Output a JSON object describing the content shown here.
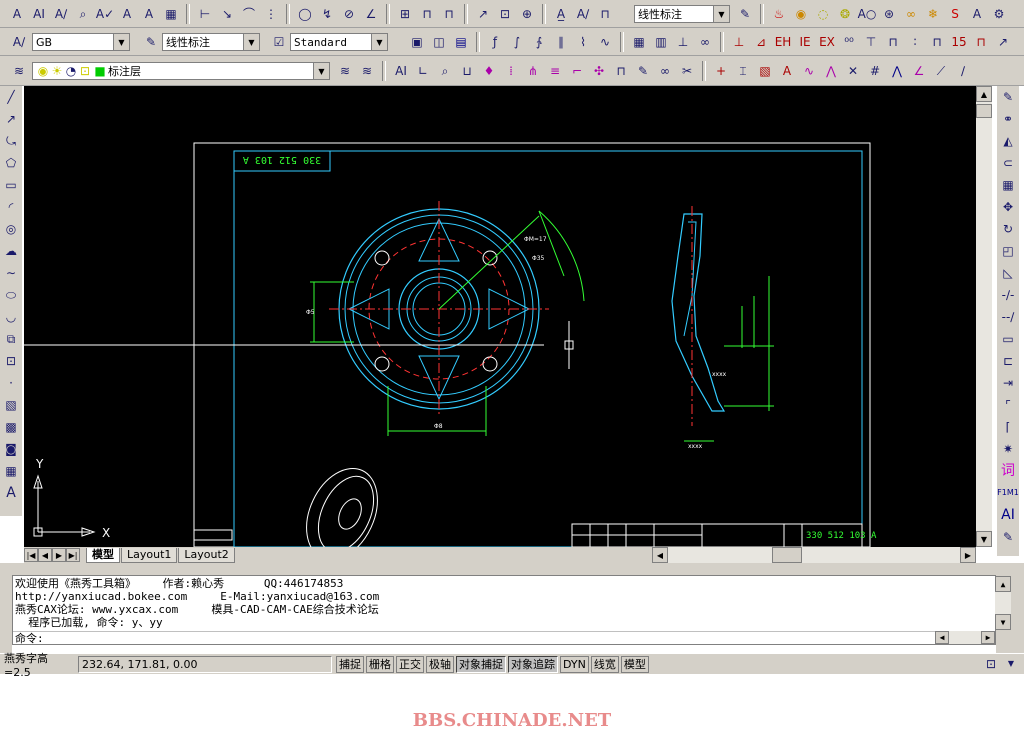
{
  "toolbar1": {
    "dimstyle_combo": "线性标注"
  },
  "toolbar2": {
    "textstyle_combo": "GB",
    "dimstyle_combo": "线性标注",
    "tablestyle_combo": "Standard"
  },
  "toolbar3": {
    "layer_combo": "标注层"
  },
  "drawing": {
    "title_block_code": "330 512 103 A",
    "frame_label": "330 512 103 A",
    "dim_d1": "ΦM=17",
    "dim_d2": "Φ35",
    "dim_d3": "Φ8",
    "dim_d4": "Φ5",
    "dim_small": "xxxx",
    "ucs_y": "Y",
    "ucs_x": "X"
  },
  "tabs": {
    "model": "模型",
    "layout1": "Layout1",
    "layout2": "Layout2"
  },
  "command": {
    "line1": "欢迎使用《燕秀工具箱》    作者:赖心秀      QQ:446174853",
    "line2": "http://yanxiucad.bokee.com     E-Mail:yanxiucad@163.com",
    "line3": "燕秀CAX论坛: www.yxcax.com     模具-CAD-CAM-CAE综合技术论坛",
    "line4": "  程序已加载, 命令: y、yy",
    "prompt": "命令:"
  },
  "status": {
    "text_height": "燕秀字高=2.5",
    "coords": "232.64, 171.81, 0.00",
    "buttons": [
      "捕捉",
      "栅格",
      "正交",
      "极轴",
      "对象捕捉",
      "对象追踪",
      "DYN",
      "线宽",
      "模型"
    ]
  },
  "watermark": "BBS.CHINADE.NET",
  "colors": {
    "canvas": "#000000",
    "cyan": "#33ccff",
    "green": "#33ff33",
    "red": "#ff3333",
    "white": "#ffffff"
  }
}
